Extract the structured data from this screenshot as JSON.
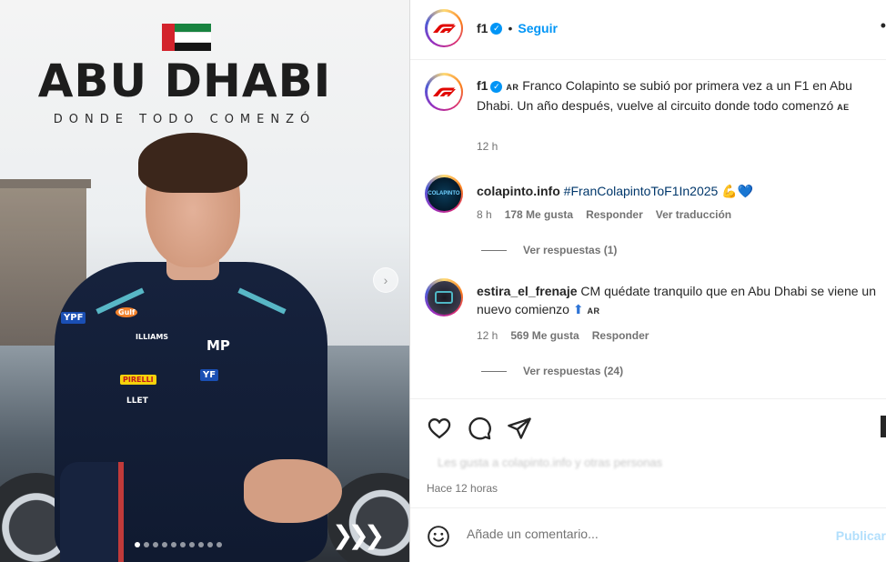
{
  "image": {
    "headline": "ABU DHABI",
    "tagline": "DONDE TODO COMENZÓ",
    "carousel_next_glyph": "›",
    "carousel_dots_total": 10,
    "carousel_dots_active": 0,
    "chevrons": "❯❯❯",
    "suit_logos": [
      "YPF",
      "Gulf",
      "ILLIAMS",
      "MP",
      "YF",
      "PIRELLI",
      "LLET"
    ]
  },
  "header": {
    "username": "f1",
    "separator": "•",
    "follow_label": "Seguir",
    "more_glyph": "•"
  },
  "caption": {
    "username": "f1",
    "lang_tag": "AR",
    "text": "Franco Colapinto se subió por primera vez a un F1 en Abu Dhabi. Un año después, vuelve al circuito donde todo comenzó",
    "end_tag": "AE",
    "time": "12 h"
  },
  "comments": [
    {
      "username": "colapinto.info",
      "text": "#FranColapintoToF1In2025 💪💙",
      "time": "8 h",
      "likes": "178 Me gusta",
      "reply_label": "Responder",
      "translate_label": "Ver traducción",
      "replies_label": "Ver respuestas (1)"
    },
    {
      "username": "estira_el_frenaje",
      "text": "CM quédate tranquilo que en Abu Dhabi se viene un nuevo comienzo",
      "tag": "AR",
      "time": "12 h",
      "likes": "569 Me gusta",
      "reply_label": "Responder",
      "replies_label": "Ver respuestas (24)"
    }
  ],
  "actions": {
    "timestamp": "Hace 12 horas",
    "likes_blurred": "Les gusta a colapinto.info y otras personas"
  },
  "add_comment": {
    "placeholder": "Añade un comentario...",
    "publish_label": "Publicar"
  },
  "colors": {
    "link_blue": "#0095f6",
    "muted_text": "#737373",
    "publish_disabled": "#b2dffc"
  }
}
